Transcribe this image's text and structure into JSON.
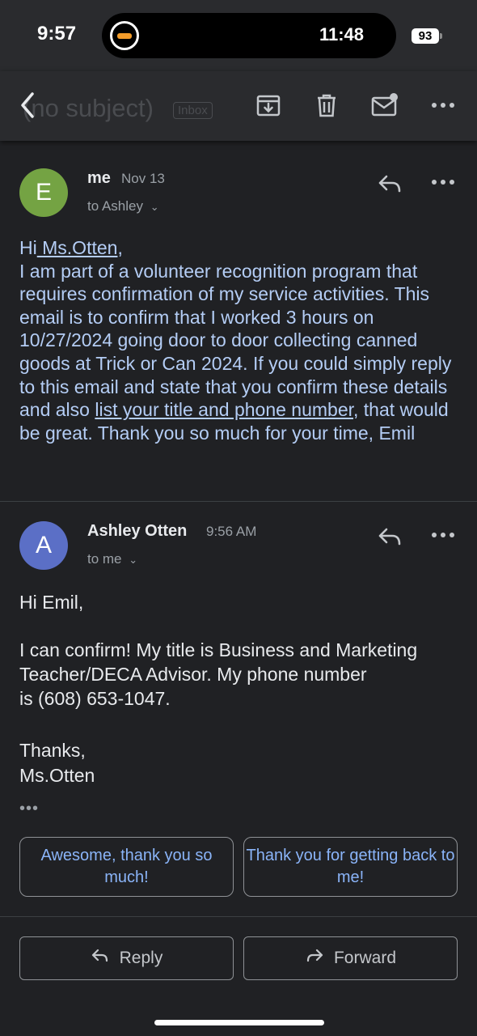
{
  "status_bar": {
    "time": "9:57",
    "activity_timer": "11:48",
    "battery": "93"
  },
  "toolbar": {
    "subject": "(no subject)",
    "label": "Inbox",
    "icons": [
      "back-arrow-icon",
      "archive-icon",
      "trash-icon",
      "mark-unread-icon",
      "more-icon"
    ]
  },
  "messages": [
    {
      "avatar_letter": "E",
      "avatar_color": "#74a343",
      "sender": "me",
      "date": "Nov 13",
      "recipient": "to Ashley",
      "body": {
        "greeting_prefix": "Hi",
        "greeting_name": " Ms.Otten",
        "greeting_suffix": ",",
        "text_part1": "I am part of a volunteer recognition program that requires confirmation of my service activities. This email is to confirm that I worked 3 hours on 10/27/2024 going door to door collecting canned goods at Trick or Can 2024. If you could simply reply to this email and state that you confirm these details and also ",
        "link_text": "list your title and phone number",
        "text_part2": ", that would be great. Thank you so much for your time, Emil"
      }
    },
    {
      "avatar_letter": "A",
      "avatar_color": "#5b6fc6",
      "sender": "Ashley Otten",
      "date": "9:56 AM",
      "recipient": "to me",
      "body": {
        "greeting": "Hi Emil,",
        "paragraph_line1": "I can confirm! My title is Business and Marketing",
        "paragraph_line2": "Teacher/DECA Advisor. My phone number",
        "paragraph_line3": "is (608) 653-1047.",
        "signoff": "Thanks,",
        "signature": "Ms.Otten",
        "trimmed_indicator": "•••"
      }
    }
  ],
  "smart_replies": [
    "Awesome, thank you so much!",
    "Thank you for getting back to me!"
  ],
  "actions": {
    "reply": "Reply",
    "forward": "Forward"
  },
  "colors": {
    "background": "#202124",
    "link": "#8ab4f8",
    "quoted_text": "#b4cdf5"
  }
}
